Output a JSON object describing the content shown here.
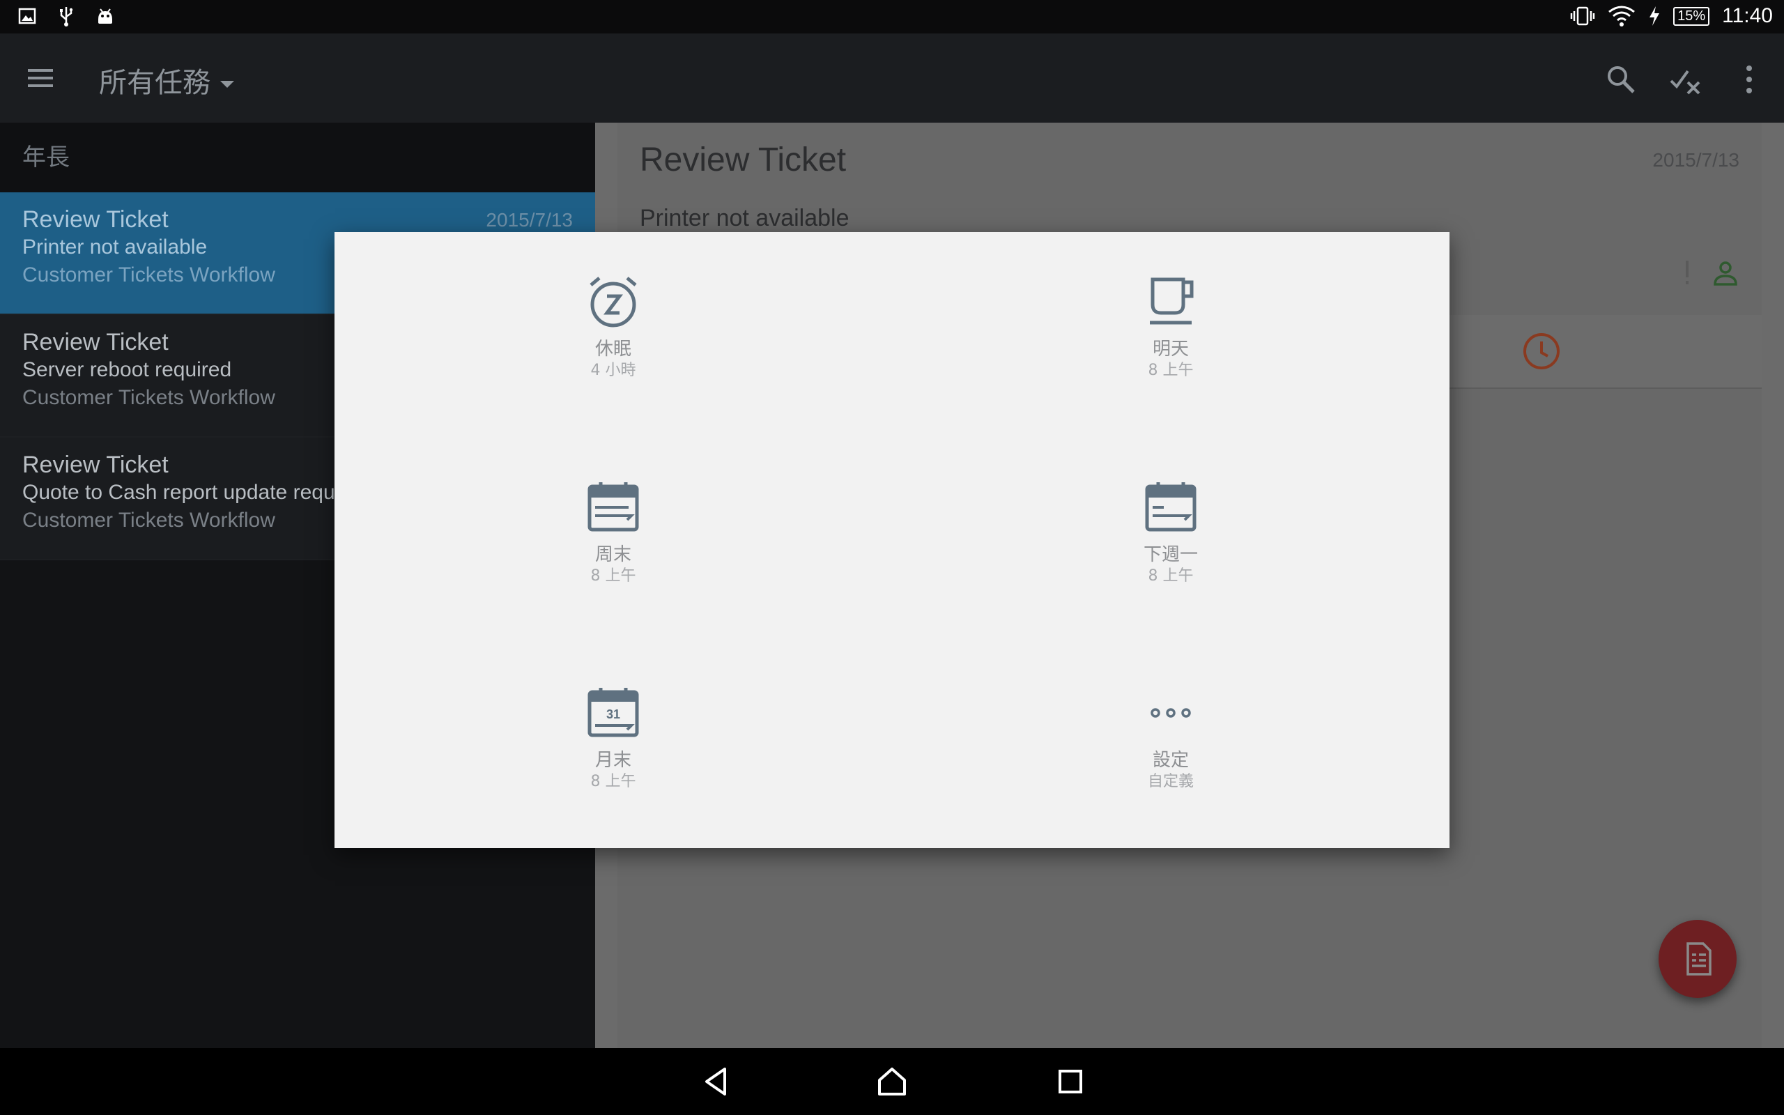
{
  "status_bar": {
    "time": "11:40",
    "battery": "15%"
  },
  "app_bar": {
    "title": "所有任務"
  },
  "list": {
    "section_header": "年長",
    "items": [
      {
        "title": "Review Ticket",
        "subtitle": "Printer not available",
        "workflow": "Customer Tickets Workflow",
        "date": "2015/7/13"
      },
      {
        "title": "Review Ticket",
        "subtitle": "Server reboot required",
        "workflow": "Customer Tickets Workflow",
        "date": ""
      },
      {
        "title": "Review Ticket",
        "subtitle": "Quote to Cash report update requ",
        "workflow": "Customer Tickets Workflow",
        "date": ""
      }
    ]
  },
  "detail": {
    "title": "Review Ticket",
    "subtitle": "Printer not available",
    "date": "2015/7/13"
  },
  "snooze_dialog": {
    "options": [
      {
        "label": "休眠",
        "sub": "4 小時",
        "icon": "alarm-snooze-icon"
      },
      {
        "label": "明天",
        "sub": "8 上午",
        "icon": "coffee-cup-icon"
      },
      {
        "label": "周末",
        "sub": "8 上午",
        "icon": "calendar-weekend-icon"
      },
      {
        "label": "下週一",
        "sub": "8 上午",
        "icon": "calendar-next-week-icon"
      },
      {
        "label": "月末",
        "sub": "8 上午",
        "icon": "calendar-month-end-icon",
        "day": "31"
      },
      {
        "label": "設定",
        "sub": "自定義",
        "icon": "more-horiz-icon"
      }
    ]
  },
  "colors": {
    "accent_blue": "#1e5f87",
    "accent_red": "#c5381f",
    "icon_gray": "#5f7180"
  }
}
